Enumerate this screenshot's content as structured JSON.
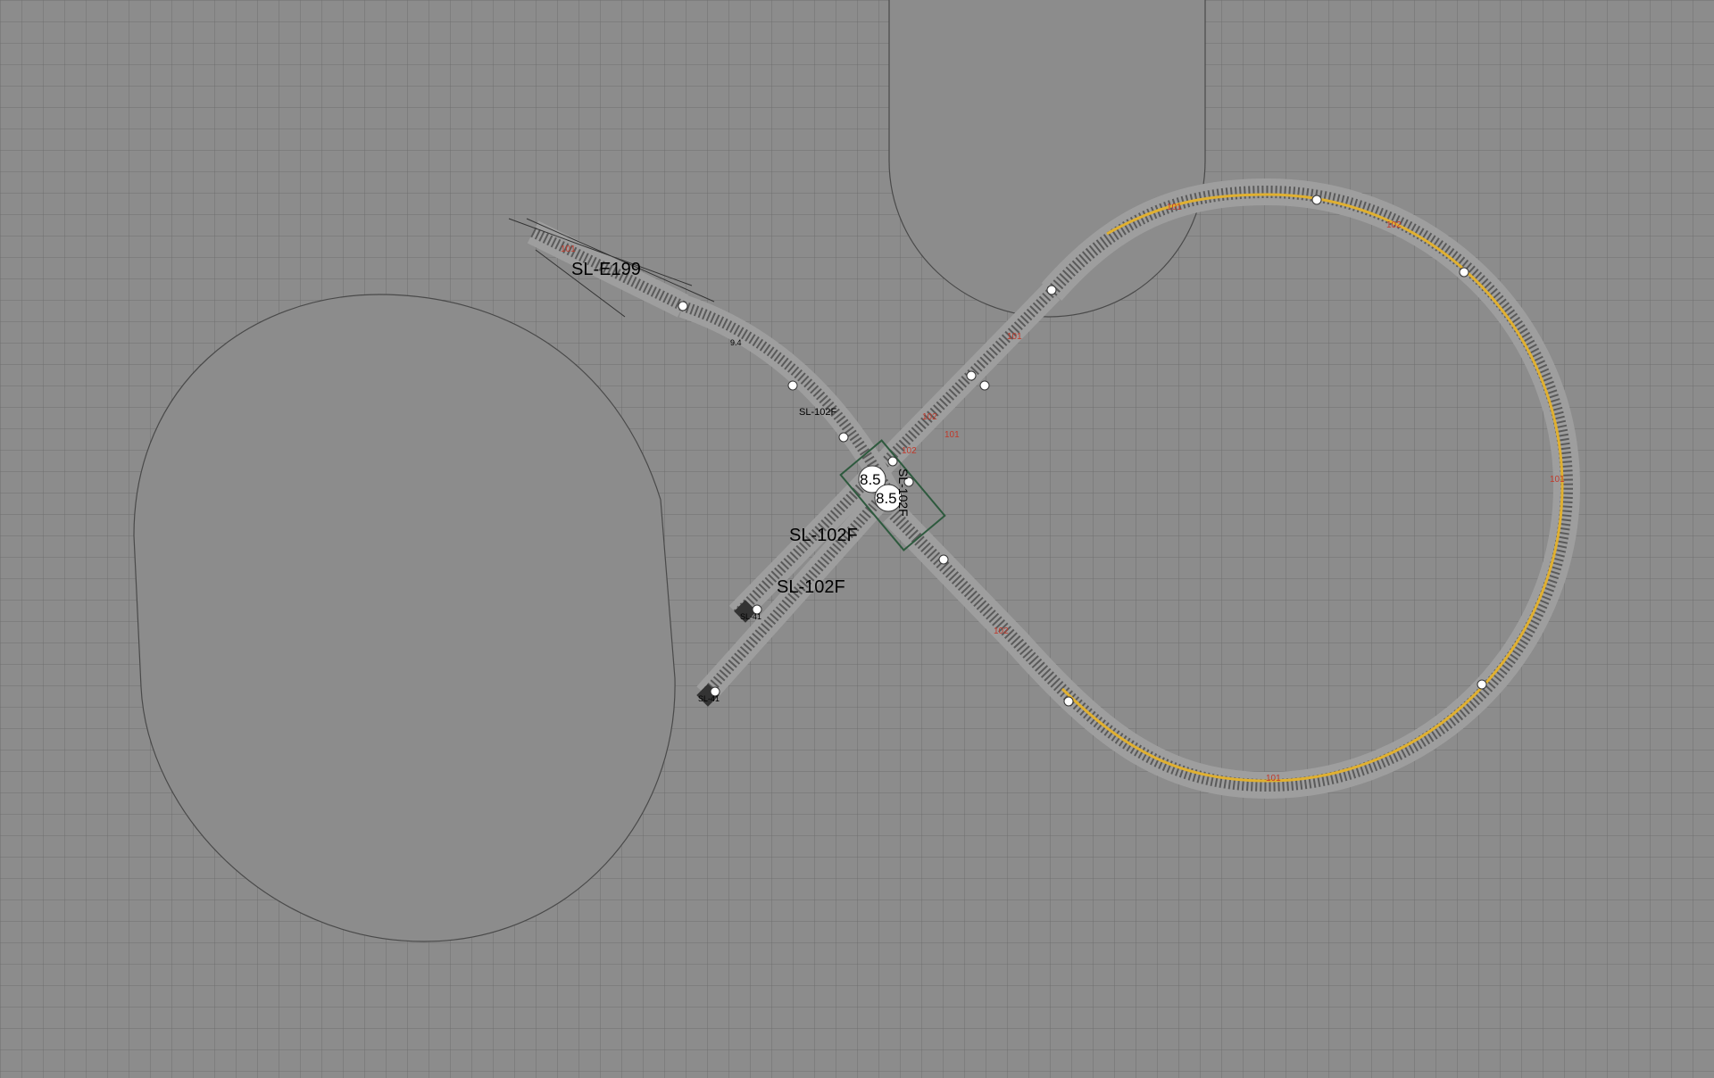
{
  "colors": {
    "background": "#8c8c8c",
    "grid": "#6f6f6f",
    "zone_stroke": "#4a4a4a",
    "ballast": "#9e9e9e",
    "rail": "#5a5a5a",
    "elevated": "#e0b030",
    "connector": "#ffffff"
  },
  "labels": {
    "turnout": "SL-E199",
    "flex_upper": "SL-102F",
    "flex_left_a": "SL-102F",
    "flex_left_b": "SL-102F",
    "crossing_a": "8.5",
    "crossing_b": "8.5",
    "crossing_side": "SL-102F",
    "stop_a": "SL-41",
    "stop_b": "SL-41",
    "small_angle": "9.4"
  },
  "red_marks": [
    "101",
    "102",
    "101",
    "101",
    "102",
    "101",
    "102",
    "101",
    "102",
    "101"
  ]
}
